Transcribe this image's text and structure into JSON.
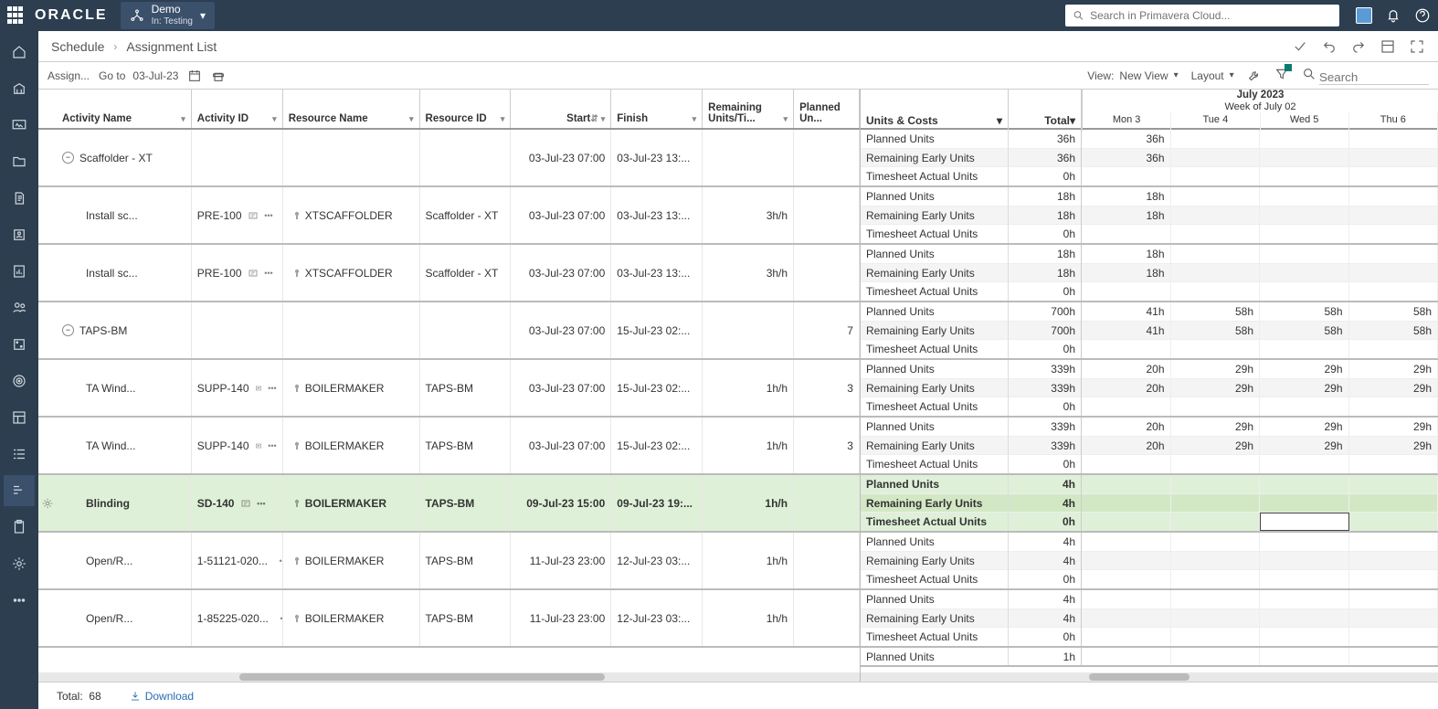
{
  "topbar": {
    "brand": "ORACLE",
    "workspace_label": "Demo",
    "workspace_sub": "In: Testing",
    "search_placeholder": "Search in Primavera Cloud..."
  },
  "breadcrumb": {
    "level1": "Schedule",
    "level2": "Assignment List"
  },
  "toolbar": {
    "assign_label": "Assign...",
    "goto_label": "Go to",
    "goto_date": "03-Jul-23",
    "view_label": "View:",
    "view_name": "New View",
    "layout_label": "Layout",
    "search_placeholder": "Search"
  },
  "left_headers": {
    "activity_name": "Activity Name",
    "activity_id": "Activity ID",
    "resource_name": "Resource Name",
    "resource_id": "Resource ID",
    "start": "Start",
    "finish": "Finish",
    "remaining": "Remaining Units/Ti...",
    "planned": "Planned Un..."
  },
  "right_headers": {
    "units_costs": "Units & Costs",
    "total": "Total",
    "month": "July 2023",
    "week": "Week of July 02",
    "days": [
      "Mon 3",
      "Tue 4",
      "Wed 5",
      "Thu 6"
    ]
  },
  "unit_labels": {
    "planned": "Planned Units",
    "remaining": "Remaining Early Units",
    "actual": "Timesheet Actual Units"
  },
  "rows": [
    {
      "group": true,
      "activity": "Scaffolder - XT",
      "activity_id": "",
      "resource": "",
      "resource_id": "",
      "start": "03-Jul-23 07:00",
      "finish": "03-Jul-23 13:...",
      "rem": "",
      "plan": ""
    },
    {
      "activity": "Install sc...",
      "activity_id": "PRE-100",
      "resource": "XTSCAFFOLDER",
      "resource_id": "Scaffolder - XT",
      "start": "03-Jul-23 07:00",
      "finish": "03-Jul-23 13:...",
      "rem": "3h/h",
      "plan": ""
    },
    {
      "activity": "Install sc...",
      "activity_id": "PRE-100",
      "resource": "XTSCAFFOLDER",
      "resource_id": "Scaffolder - XT",
      "start": "03-Jul-23 07:00",
      "finish": "03-Jul-23 13:...",
      "rem": "3h/h",
      "plan": ""
    },
    {
      "group": true,
      "activity": "TAPS-BM",
      "activity_id": "",
      "resource": "",
      "resource_id": "",
      "start": "03-Jul-23 07:00",
      "finish": "15-Jul-23 02:...",
      "rem": "",
      "plan": "7"
    },
    {
      "activity": "TA Wind...",
      "activity_id": "SUPP-140",
      "resource": "BOILERMAKER",
      "resource_id": "TAPS-BM",
      "start": "03-Jul-23 07:00",
      "finish": "15-Jul-23 02:...",
      "rem": "1h/h",
      "plan": "3"
    },
    {
      "activity": "TA Wind...",
      "activity_id": "SUPP-140",
      "resource": "BOILERMAKER",
      "resource_id": "TAPS-BM",
      "start": "03-Jul-23 07:00",
      "finish": "15-Jul-23 02:...",
      "rem": "1h/h",
      "plan": "3"
    },
    {
      "selected": true,
      "activity": "Blinding",
      "activity_id": "SD-140",
      "resource": "BOILERMAKER",
      "resource_id": "TAPS-BM",
      "start": "09-Jul-23 15:00",
      "finish": "09-Jul-23 19:...",
      "rem": "1h/h",
      "plan": ""
    },
    {
      "activity": "Open/R...",
      "activity_id": "1-51121-020...",
      "resource": "BOILERMAKER",
      "resource_id": "TAPS-BM",
      "start": "11-Jul-23 23:00",
      "finish": "12-Jul-23 03:...",
      "rem": "1h/h",
      "plan": ""
    },
    {
      "activity": "Open/R...",
      "activity_id": "1-85225-020...",
      "resource": "BOILERMAKER",
      "resource_id": "TAPS-BM",
      "start": "11-Jul-23 23:00",
      "finish": "12-Jul-23 03:...",
      "rem": "1h/h",
      "plan": ""
    }
  ],
  "units": [
    {
      "tot": [
        "36h",
        "36h",
        "0h"
      ],
      "days": [
        [
          "36h",
          "",
          "",
          ""
        ],
        [
          "36h",
          "",
          "",
          ""
        ],
        [
          "",
          "",
          "",
          ""
        ]
      ]
    },
    {
      "tot": [
        "18h",
        "18h",
        "0h"
      ],
      "days": [
        [
          "18h",
          "",
          "",
          ""
        ],
        [
          "18h",
          "",
          "",
          ""
        ],
        [
          "",
          "",
          "",
          ""
        ]
      ]
    },
    {
      "tot": [
        "18h",
        "18h",
        "0h"
      ],
      "days": [
        [
          "18h",
          "",
          "",
          ""
        ],
        [
          "18h",
          "",
          "",
          ""
        ],
        [
          "",
          "",
          "",
          ""
        ]
      ]
    },
    {
      "tot": [
        "700h",
        "700h",
        "0h"
      ],
      "days": [
        [
          "41h",
          "58h",
          "58h",
          "58h"
        ],
        [
          "41h",
          "58h",
          "58h",
          "58h"
        ],
        [
          "",
          "",
          "",
          ""
        ]
      ]
    },
    {
      "tot": [
        "339h",
        "339h",
        "0h"
      ],
      "days": [
        [
          "20h",
          "29h",
          "29h",
          "29h"
        ],
        [
          "20h",
          "29h",
          "29h",
          "29h"
        ],
        [
          "",
          "",
          "",
          ""
        ]
      ]
    },
    {
      "tot": [
        "339h",
        "339h",
        "0h"
      ],
      "days": [
        [
          "20h",
          "29h",
          "29h",
          "29h"
        ],
        [
          "20h",
          "29h",
          "29h",
          "29h"
        ],
        [
          "",
          "",
          "",
          ""
        ]
      ]
    },
    {
      "tot": [
        "4h",
        "4h",
        "0h"
      ],
      "days": [
        [
          "",
          "",
          "",
          ""
        ],
        [
          "",
          "",
          "",
          ""
        ],
        [
          "",
          "",
          "",
          ""
        ]
      ]
    },
    {
      "tot": [
        "4h",
        "4h",
        "0h"
      ],
      "days": [
        [
          "",
          "",
          "",
          ""
        ],
        [
          "",
          "",
          "",
          ""
        ],
        [
          "",
          "",
          "",
          ""
        ]
      ]
    },
    {
      "tot": [
        "4h",
        "4h",
        "0h"
      ],
      "days": [
        [
          "",
          "",
          "",
          ""
        ],
        [
          "",
          "",
          "",
          ""
        ],
        [
          "",
          "",
          "",
          ""
        ]
      ]
    }
  ],
  "extra_unit_row": {
    "label": "Planned Units",
    "total": "1h"
  },
  "footer": {
    "total_label": "Total:",
    "total_value": "68",
    "download": "Download"
  }
}
